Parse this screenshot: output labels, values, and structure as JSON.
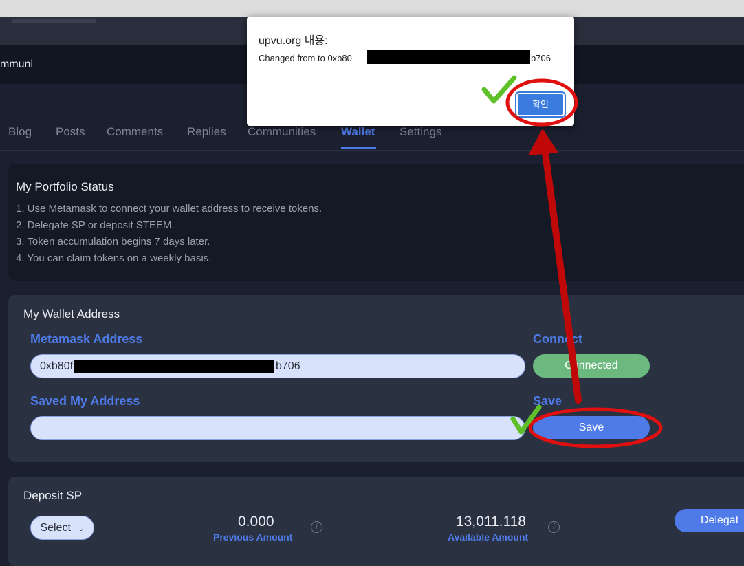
{
  "header": {
    "brand_fragment": "mmuni"
  },
  "nav": {
    "tabs": [
      "Blog",
      "Posts",
      "Comments",
      "Replies",
      "Communities",
      "Wallet",
      "Settings"
    ],
    "active": "Wallet"
  },
  "portfolio": {
    "title": "My Portfolio Status",
    "steps": [
      "1. Use Metamask to connect your wallet address to receive tokens.",
      "2. Delegate SP or deposit STEEM.",
      "3. Token accumulation begins 7 days later.",
      "4. You can claim tokens on a weekly basis."
    ]
  },
  "wallet": {
    "title": "My Wallet Address",
    "metamask_label": "Metamask Address",
    "address_prefix": "0xb80f",
    "address_suffix": "b706",
    "connect_label": "Connect",
    "connected_button": "Connected",
    "saved_label": "Saved My Address",
    "saved_value": "",
    "save_label": "Save",
    "save_button": "Save"
  },
  "deposit": {
    "title": "Deposit SP",
    "select_label": "Select",
    "previous_amount": "0.000",
    "previous_label": "Previous Amount",
    "available_amount": "13,011.118",
    "available_label": "Available Amount",
    "delegate_button": "Delegat"
  },
  "dialog": {
    "title": "upvu.org 내용:",
    "message_prefix": "Changed from  to 0xb80",
    "message_suffix": "b706",
    "ok_button": "확인"
  },
  "colors": {
    "accent": "#4f7be8",
    "connected": "#6bb97f",
    "annotation": "#e01010",
    "check": "#5fc02a"
  }
}
